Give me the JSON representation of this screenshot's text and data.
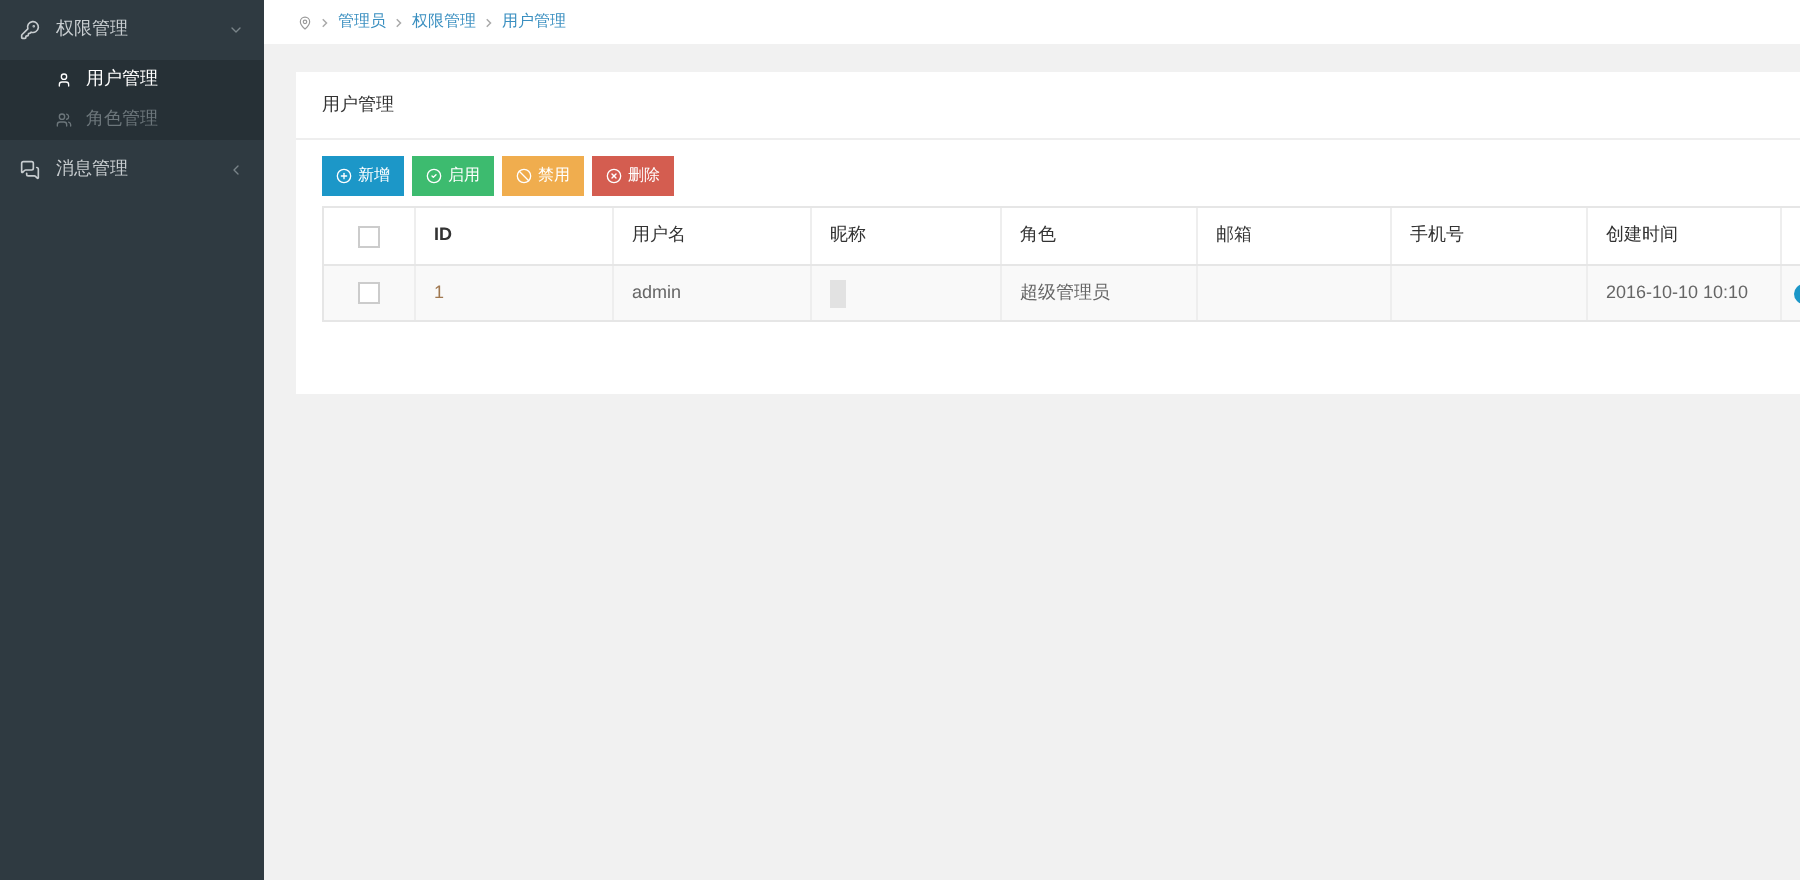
{
  "sidebar": {
    "items": [
      {
        "label": "权限管理",
        "expanded": true,
        "children": [
          {
            "label": "用户管理",
            "selected": true
          },
          {
            "label": "角色管理",
            "selected": false
          }
        ]
      },
      {
        "label": "消息管理",
        "expanded": false
      }
    ]
  },
  "breadcrumb": [
    "管理员",
    "权限管理",
    "用户管理"
  ],
  "panel": {
    "title": "用户管理",
    "buttons": [
      {
        "label": "新增",
        "kind": "add"
      },
      {
        "label": "启用",
        "kind": "enable"
      },
      {
        "label": "禁用",
        "kind": "disable"
      },
      {
        "label": "删除",
        "kind": "delete"
      }
    ],
    "table": {
      "all_checked": false,
      "columns": [
        "ID",
        "用户名",
        "昵称",
        "角色",
        "邮箱",
        "手机号",
        "创建时间"
      ],
      "rows": [
        {
          "checked": false,
          "cells": [
            "1",
            "admin",
            "",
            "超级管理员",
            "",
            "",
            "2016-10-10 10:10"
          ]
        }
      ]
    }
  }
}
